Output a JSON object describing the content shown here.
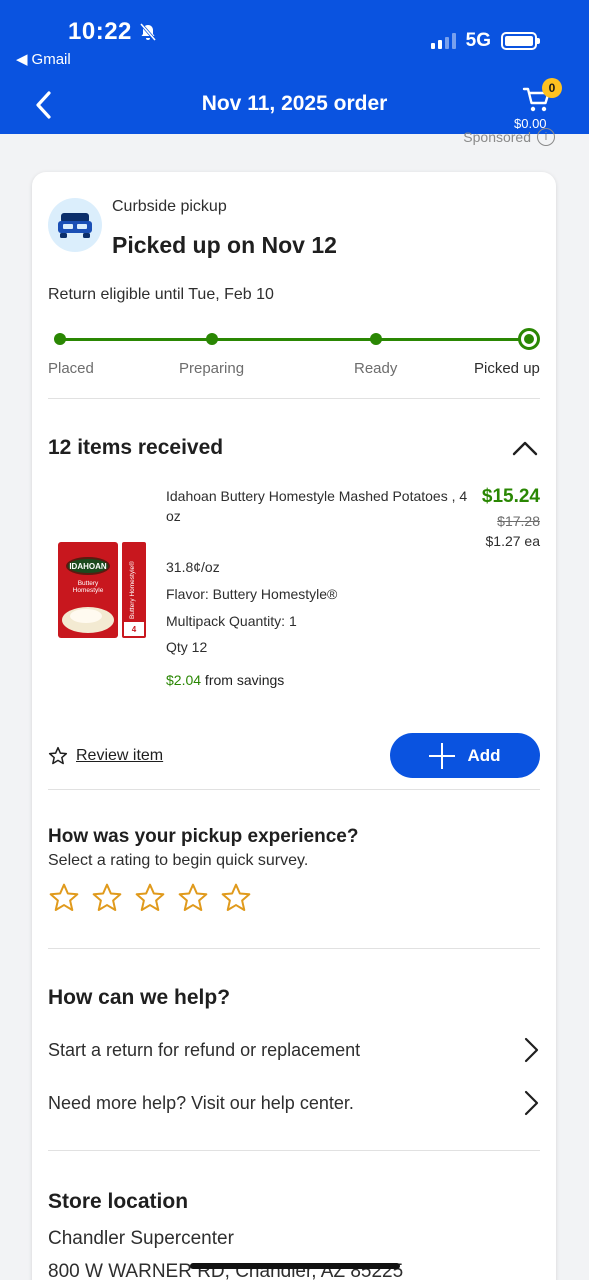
{
  "status_bar": {
    "time": "10:22",
    "back_app": "Gmail",
    "network": "5G"
  },
  "header": {
    "title": "Nov 11, 2025 order",
    "cart_count": "0",
    "cart_total": "$0.00"
  },
  "sponsored": {
    "label": "Sponsored",
    "info": "i"
  },
  "order": {
    "method": "Curbside pickup",
    "status_title": "Picked up on Nov 12",
    "return_eligible": "Return eligible until Tue, Feb 10",
    "steps": [
      "Placed",
      "Preparing",
      "Ready",
      "Picked up"
    ],
    "current_step": 3
  },
  "items": {
    "heading": "12 items received",
    "product": {
      "name": "Idahoan Buttery Homestyle Mashed Potatoes , 4 oz",
      "price": "$15.24",
      "was_price": "$17.28",
      "each_price": "$1.27 ea",
      "unit_price": "31.8¢/oz",
      "flavor": "Flavor: Buttery Homestyle®",
      "multipack": "Multipack Quantity: 1",
      "qty": "Qty 12",
      "savings_amount": "$2.04",
      "savings_text": " from savings",
      "package": {
        "brand": "IDAHOAN",
        "flavor_line1": "Buttery",
        "flavor_line2": "Homestyle",
        "side_text": "Buttery Homestyle®",
        "servings_num": "4"
      }
    },
    "review_label": "Review item",
    "add_label": "Add"
  },
  "survey": {
    "title": "How was your pickup experience?",
    "subtitle": "Select a rating to begin quick survey.",
    "star_count": 5,
    "star_color": "#e09a1c"
  },
  "help": {
    "title": "How can we help?",
    "rows": [
      "Start a return for refund or replacement",
      "Need more help? Visit our help center."
    ]
  },
  "store": {
    "title": "Store location",
    "name": "Chandler Supercenter",
    "address": "800 W WARNER RD, Chandler, AZ 85225"
  },
  "colors": {
    "brand_blue": "#0a53e0",
    "success_green": "#2a8703",
    "spark_yellow": "#ffc220"
  }
}
